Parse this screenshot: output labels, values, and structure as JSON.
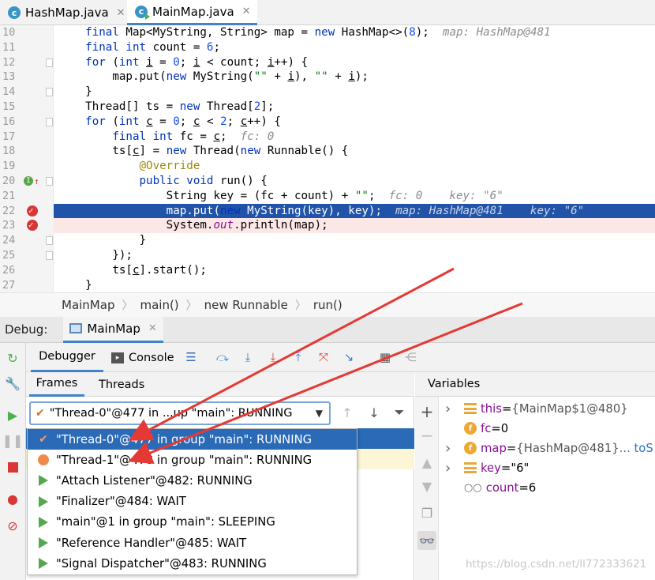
{
  "editor_tabs": [
    {
      "label": "HashMap.java",
      "active": false
    },
    {
      "label": "MainMap.java",
      "active": true
    }
  ],
  "code_lines": [
    {
      "n": "10",
      "html": "    <span class=\"kw\">final</span> Map&lt;MyString, String&gt; map = <span class=\"kw\">new</span> HashMap&lt;&gt;(<span class=\"num\">8</span>);  <span class=\"inl\">map: HashMap@481</span>"
    },
    {
      "n": "11",
      "html": "    <span class=\"kw\">final int</span> count = <span class=\"num\">6</span>;"
    },
    {
      "n": "12",
      "html": "    <span class=\"kw\">for</span> (<span class=\"kw\">int</span> <span class=\"var\">i</span> = <span class=\"num\">0</span>; <span class=\"var\">i</span> &lt; count; <span class=\"var\">i</span>++) {"
    },
    {
      "n": "13",
      "html": "        map.put(<span class=\"kw\">new</span> MyString(<span class=\"str\">\"\"</span> + <span class=\"var\">i</span>), <span class=\"str\">\"\"</span> + <span class=\"var\">i</span>);"
    },
    {
      "n": "14",
      "html": "    }"
    },
    {
      "n": "15",
      "html": "    Thread[] ts = <span class=\"kw\">new</span> Thread[<span class=\"num\">2</span>];"
    },
    {
      "n": "16",
      "html": "    <span class=\"kw\">for</span> (<span class=\"kw\">int</span> <span class=\"var\">c</span> = <span class=\"num\">0</span>; <span class=\"var\">c</span> &lt; <span class=\"num\">2</span>; <span class=\"var\">c</span>++) {"
    },
    {
      "n": "17",
      "html": "        <span class=\"kw\">final int</span> fc = <span class=\"var\">c</span>;  <span class=\"inl\">fc: 0</span>"
    },
    {
      "n": "18",
      "html": "        ts[<span class=\"var\">c</span>] = <span class=\"kw\">new</span> Thread(<span class=\"kw\">new</span> Runnable() {"
    },
    {
      "n": "19",
      "html": "            <span class=\"ann\">@Override</span>"
    },
    {
      "n": "20",
      "html": "            <span class=\"kw\">public void</span> run() {"
    },
    {
      "n": "21",
      "html": "                String key = (fc + count) + <span class=\"str\">\"\"</span>;  <span class=\"inl\">fc: 0    key: \"6\"</span>"
    },
    {
      "n": "22",
      "html": "                map.put(<span class=\"kw\">new</span> MyString(key), key);  <span class=\"inl\">map: HashMap@481    key: \"6\"</span>"
    },
    {
      "n": "23",
      "html": "                System.<span class=\"field\">out</span>.println(map);"
    },
    {
      "n": "24",
      "html": "            }"
    },
    {
      "n": "25",
      "html": "        });"
    },
    {
      "n": "26",
      "html": "        ts[<span class=\"var\">c</span>].start();"
    },
    {
      "n": "27",
      "html": "    }"
    }
  ],
  "breadcrumb": [
    "MainMap",
    "main()",
    "new Runnable",
    "run()"
  ],
  "debug": {
    "label": "Debug:",
    "session_tab": "MainMap",
    "tabs": {
      "debugger": "Debugger",
      "console": "Console"
    },
    "frames_tab": "Frames",
    "threads_tab": "Threads",
    "variables_title": "Variables",
    "selected_thread": "\"Thread-0\"@477 in ...up \"main\": RUNNING"
  },
  "threads": [
    {
      "label": "\"Thread-0\"@477 in group \"main\": RUNNING",
      "icon": "check-icon",
      "selected": true
    },
    {
      "label": "\"Thread-1\"@478 in group \"main\": RUNNING",
      "icon": "orange-dot-icon",
      "selected": false
    },
    {
      "label": "\"Attach Listener\"@482: RUNNING",
      "icon": "play-icon",
      "selected": false
    },
    {
      "label": "\"Finalizer\"@484: WAIT",
      "icon": "play-icon",
      "selected": false
    },
    {
      "label": "\"main\"@1 in group \"main\": SLEEPING",
      "icon": "play-icon",
      "selected": false
    },
    {
      "label": "\"Reference Handler\"@485: WAIT",
      "icon": "play-icon",
      "selected": false
    },
    {
      "label": "\"Signal Dispatcher\"@483: RUNNING",
      "icon": "play-icon",
      "selected": false
    }
  ],
  "variables": [
    {
      "name": "this",
      "eq": " = ",
      "value": "{MainMap$1@480}",
      "expandable": true,
      "icon": "stack-icon",
      "kind": "obj"
    },
    {
      "name": "fc",
      "eq": " = ",
      "value": "0",
      "expandable": false,
      "icon": "field-icon",
      "kind": "val"
    },
    {
      "name": "map",
      "eq": " = ",
      "value": "{HashMap@481}",
      "extra": "... toS",
      "expandable": true,
      "icon": "field-icon",
      "kind": "obj"
    },
    {
      "name": "key",
      "eq": " = ",
      "value": "\"6\"",
      "expandable": true,
      "icon": "stack-icon",
      "kind": "val"
    },
    {
      "name": "count",
      "eq": " = ",
      "value": "6",
      "expandable": false,
      "icon": "watch-icon",
      "kind": "val"
    }
  ],
  "watermark": "https://blog.csdn.net/ll772333621",
  "colors": {
    "accent": "#2a6ab6",
    "exec_line": "#2154a8",
    "breakpoint": "#d93636",
    "arrow": "#e53935"
  }
}
